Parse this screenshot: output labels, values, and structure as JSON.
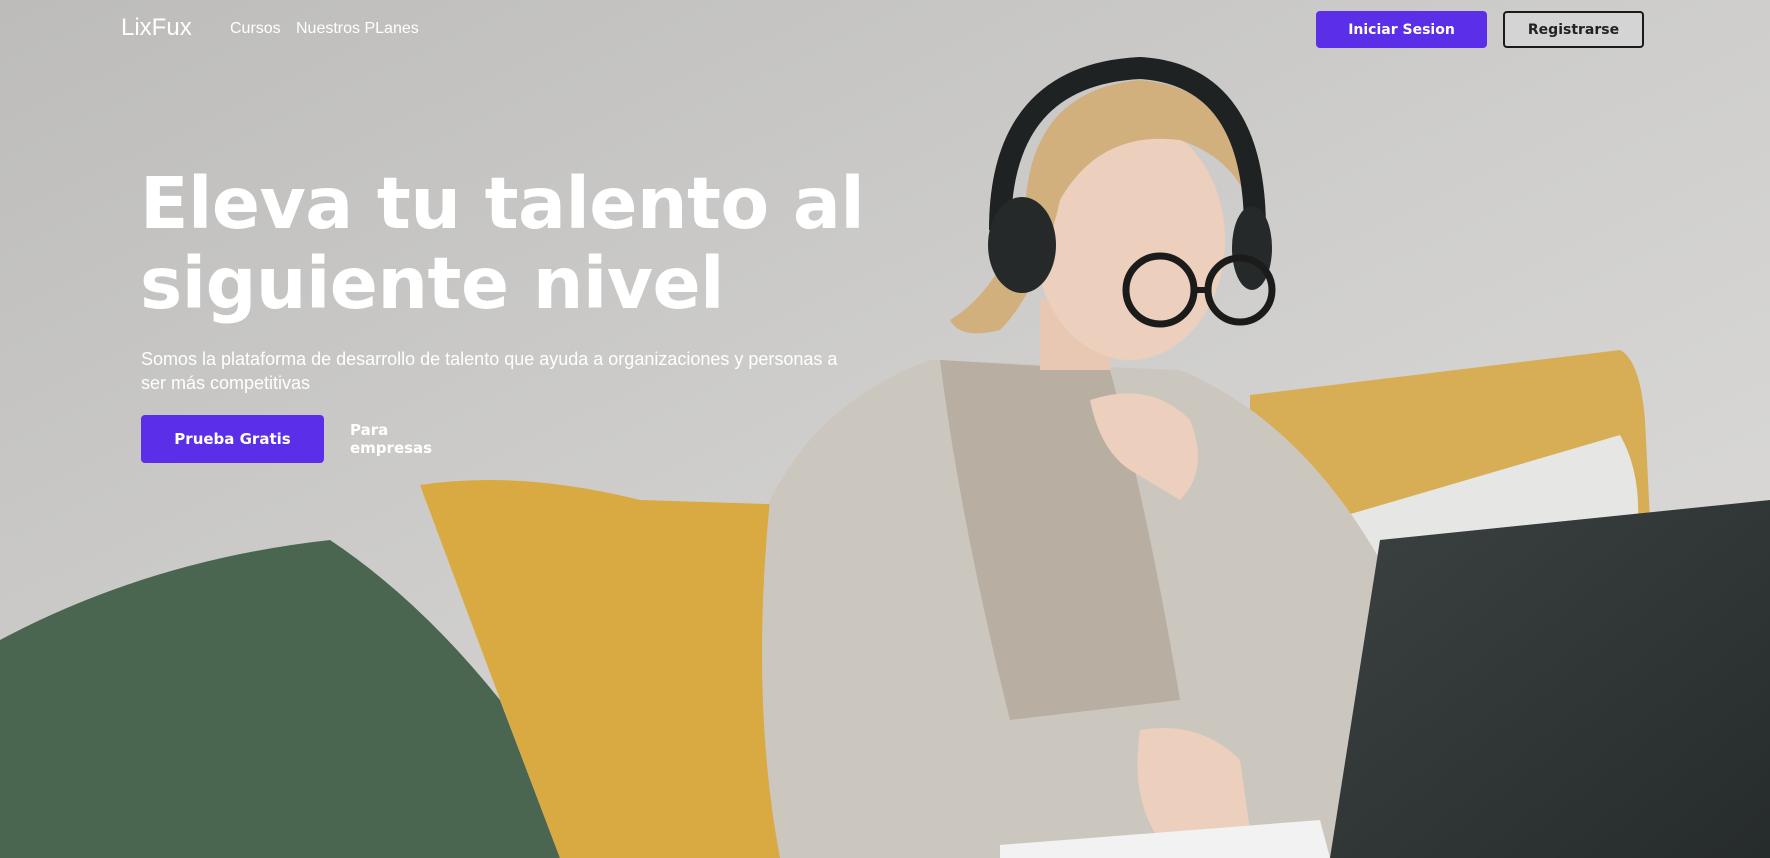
{
  "nav": {
    "logo": "LixFux",
    "links": [
      "Cursos",
      "Nuestros PLanes"
    ],
    "login_label": "Iniciar Sesion",
    "register_label": "Registrarse"
  },
  "hero": {
    "headline_line1": "Eleva tu talento al",
    "headline_line2": "siguiente nivel",
    "subtitle": "Somos la plataforma de desarrollo de talento que ayuda a organizaciones y personas a ser más competitivas",
    "primary_cta": "Prueba Gratis",
    "secondary_cta": "Para empresas"
  },
  "colors": {
    "accent": "#5b2ee8",
    "register_bg": "#d4d4d4"
  }
}
